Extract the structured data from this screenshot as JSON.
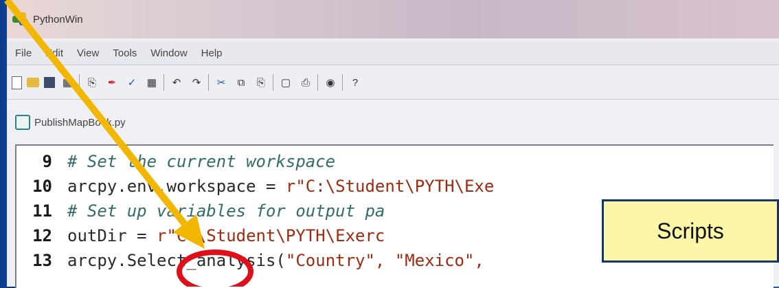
{
  "window": {
    "title": "PythonWin"
  },
  "menu": {
    "items": [
      "File",
      "Edit",
      "View",
      "Tools",
      "Window",
      "Help"
    ]
  },
  "toolbar": {
    "icons": [
      "new-document-icon",
      "open-folder-icon",
      "save-icon",
      "save-all-icon",
      "paste-icon",
      "brush-icon",
      "check-icon",
      "grid-icon",
      "undo-icon",
      "redo-icon",
      "cut-icon",
      "copy-icon",
      "paste-clip-icon",
      "print-preview-icon",
      "print-icon",
      "python-icon",
      "help-icon"
    ]
  },
  "document": {
    "tab_label": "PublishMapBook.py"
  },
  "code": {
    "lines": [
      {
        "num": "9",
        "comment": "# Set the current workspace"
      },
      {
        "num": "10",
        "code": "arcpy.env.workspace = ",
        "str": "r\"C:\\Student\\PYTH\\Exe"
      },
      {
        "num": "11",
        "comment": "# Set up variables for output pa"
      },
      {
        "num": "12",
        "code": "outDir = ",
        "str": "r\"C:\\Student\\PYTH\\Exerc"
      },
      {
        "num": "13",
        "code": "arcpy.Select_analysis(",
        "str": "\"Country\", \"Mexico\","
      }
    ]
  },
  "callout": {
    "label": "Scripts"
  },
  "colors": {
    "arrow": "#f2b705",
    "highlight_circle": "#e0101a",
    "callout_bg": "#fbf6a8"
  }
}
